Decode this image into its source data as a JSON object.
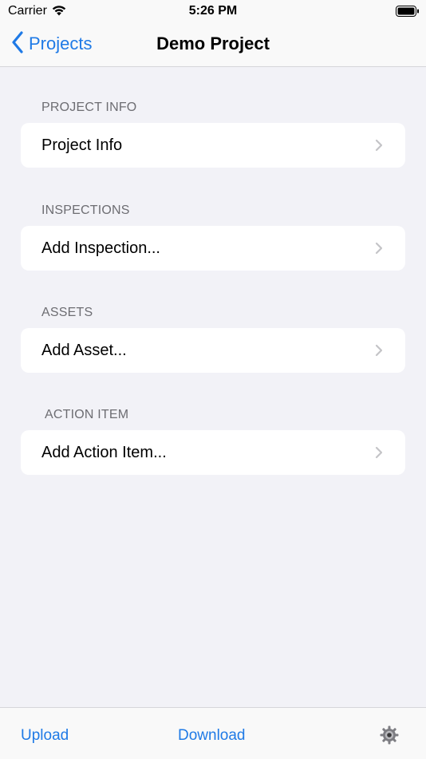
{
  "status_bar": {
    "carrier": "Carrier",
    "time": "5:26 PM"
  },
  "nav": {
    "back_label": "Projects",
    "title": "Demo Project"
  },
  "sections": [
    {
      "header": "PROJECT INFO",
      "item": "Project Info"
    },
    {
      "header": "INSPECTIONS",
      "item": "Add Inspection..."
    },
    {
      "header": "ASSETS",
      "item": "Add Asset..."
    },
    {
      "header": "ACTION ITEM",
      "item": "Add Action Item..."
    }
  ],
  "toolbar": {
    "upload_label": "Upload",
    "download_label": "Download",
    "settings_icon": "gear-icon"
  },
  "colors": {
    "accent": "#1f7ae6",
    "background": "#f2f2f7",
    "header_text": "#6d6d72"
  }
}
